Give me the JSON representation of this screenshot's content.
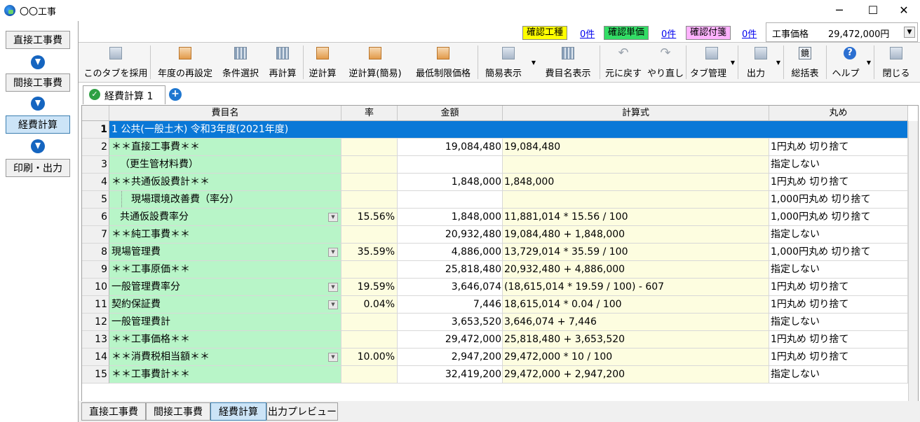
{
  "window": {
    "title": "〇〇工事",
    "minimize": "─",
    "maximize": "☐",
    "close": "✕"
  },
  "steps": [
    "直接工事費",
    "間接工事費",
    "経費計算",
    "印刷・出力"
  ],
  "status": {
    "badges": [
      {
        "label": "確認工種",
        "count": "0件",
        "color": "#ffff00"
      },
      {
        "label": "確認単価",
        "count": "0件",
        "color": "#33dd66"
      },
      {
        "label": "確認付箋",
        "count": "0件",
        "color": "#ffb3ff"
      }
    ],
    "price_label": "工事価格",
    "price_value": "29,472,000円"
  },
  "toolbar": {
    "adopt_tab": "このタブを採用",
    "reset_year": "年度の再設定",
    "select_cond": "条件選択",
    "recalc": "再計算",
    "reverse_calc": "逆計算",
    "reverse_calc_simple": "逆計算(簡易)",
    "min_limit": "最低制限価格",
    "simple_view": "簡易表示",
    "item_name_view": "費目名表示",
    "undo": "元に戻す",
    "redo": "やり直し",
    "tab_manage": "タブ管理",
    "output": "出力",
    "summary": "総括表",
    "summary_icon_text": "鏡",
    "help": "ヘルプ",
    "close": "閉じる"
  },
  "tabs": {
    "active_label": "経費計算 1",
    "add": "+"
  },
  "grid": {
    "headers": {
      "name": "費目名",
      "rate": "率",
      "amount": "金額",
      "formula": "計算式",
      "rounding": "丸め"
    },
    "title_row": {
      "num": "1",
      "text": "1 公共(一般土木) 令和3年度(2021年度)"
    },
    "rows": [
      {
        "num": "2",
        "name": "＊＊直接工事費＊＊",
        "rate": "",
        "amount": "19,084,480",
        "formula": "19,084,480",
        "rounding": "1円丸め 切り捨て"
      },
      {
        "num": "3",
        "name": "（更生管材料費）",
        "rate": "",
        "amount": "",
        "formula": "",
        "rounding": "指定しない"
      },
      {
        "num": "4",
        "name": "＊＊共通仮設費計＊＊",
        "rate": "",
        "amount": "1,848,000",
        "formula": "1,848,000",
        "rounding": "1円丸め 切り捨て"
      },
      {
        "num": "5",
        "name": "現場環境改善費（率分）",
        "rate": "",
        "amount": "",
        "formula": "",
        "rounding": "1,000円丸め 切り捨て"
      },
      {
        "num": "6",
        "name": "共通仮設費率分",
        "rate": "15.56%",
        "amount": "1,848,000",
        "formula": "11,881,014 * 15.56 / 100",
        "rounding": "1,000円丸め 切り捨て"
      },
      {
        "num": "7",
        "name": "＊＊純工事費＊＊",
        "rate": "",
        "amount": "20,932,480",
        "formula": "19,084,480 + 1,848,000",
        "rounding": "指定しない"
      },
      {
        "num": "8",
        "name": "現場管理費",
        "rate": "35.59%",
        "amount": "4,886,000",
        "formula": "13,729,014 * 35.59 / 100",
        "rounding": "1,000円丸め 切り捨て"
      },
      {
        "num": "9",
        "name": "＊＊工事原価＊＊",
        "rate": "",
        "amount": "25,818,480",
        "formula": "20,932,480 + 4,886,000",
        "rounding": "指定しない"
      },
      {
        "num": "10",
        "name": "一般管理費率分",
        "rate": "19.59%",
        "amount": "3,646,074",
        "formula": "(18,615,014 * 19.59 / 100) - 607",
        "rounding": "1円丸め 切り捨て"
      },
      {
        "num": "11",
        "name": "契約保証費",
        "rate": "0.04%",
        "amount": "7,446",
        "formula": "18,615,014 * 0.04 / 100",
        "rounding": "1円丸め 切り捨て"
      },
      {
        "num": "12",
        "name": "一般管理費計",
        "rate": "",
        "amount": "3,653,520",
        "formula": "3,646,074 + 7,446",
        "rounding": "指定しない"
      },
      {
        "num": "13",
        "name": "＊＊工事価格＊＊",
        "rate": "",
        "amount": "29,472,000",
        "formula": "25,818,480 + 3,653,520",
        "rounding": "1円丸め 切り捨て"
      },
      {
        "num": "14",
        "name": "＊＊消費税相当額＊＊",
        "rate": "10.00%",
        "amount": "2,947,200",
        "formula": "29,472,000 * 10 / 100",
        "rounding": "1円丸め 切り捨て"
      },
      {
        "num": "15",
        "name": "＊＊工事費計＊＊",
        "rate": "",
        "amount": "32,419,200",
        "formula": "29,472,000 + 2,947,200",
        "rounding": "指定しない"
      }
    ]
  },
  "bottom_tabs": [
    "直接工事費",
    "間接工事費",
    "経費計算",
    "出力プレビュー"
  ]
}
